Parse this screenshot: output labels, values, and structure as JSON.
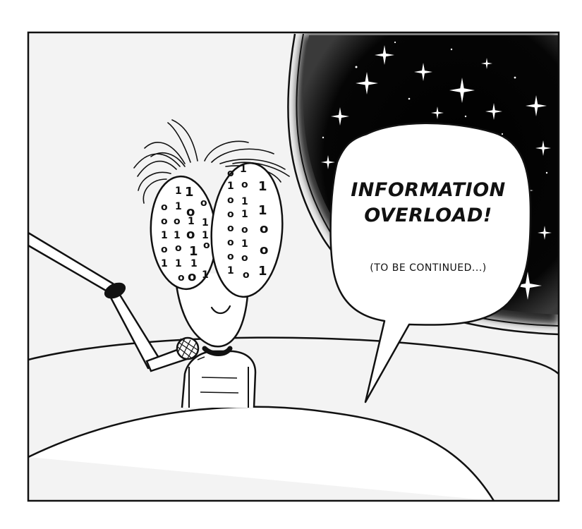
{
  "panel": {
    "speech": {
      "line1": "INFORMATION",
      "line2": "OVERLOAD!",
      "sub": "(TO BE CONTINUED...)"
    },
    "colors": {
      "ink": "#111111",
      "panel_bg": "#f3f3f3",
      "space": "#000000",
      "paper": "#ffffff"
    },
    "eyes": {
      "left": [
        "1 1",
        "0 1 0",
        "0 0 0 0",
        "1 1 0 1",
        "0 0 1 0",
        "1 1 1",
        "0 0 1"
      ],
      "right": [
        "0 1",
        "1 0 1",
        "0 1 1",
        "0 1 1",
        "0 1 0",
        "0 1 0",
        "1 0 1",
        "1 0 1"
      ]
    }
  }
}
